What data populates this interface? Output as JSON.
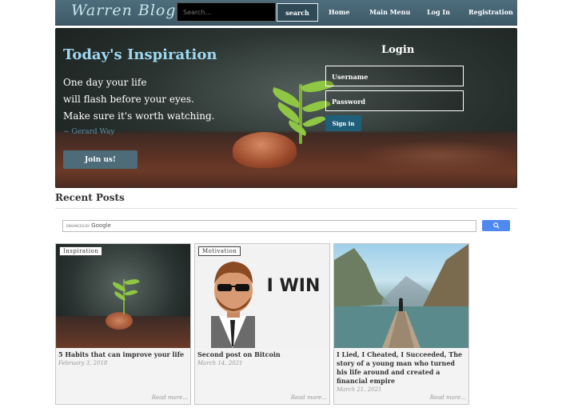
{
  "navbar": {
    "logo": "Warren Blog",
    "search_placeholder": "Search...",
    "search_button": "search",
    "links": [
      "Home",
      "Main Menu",
      "Log In",
      "Registration"
    ]
  },
  "hero": {
    "title": "Today's Inspiration",
    "quote_lines": [
      "One day your life",
      "will flash before your eyes.",
      "Make sure it's worth watching."
    ],
    "quote_author": "~ Gerard Way",
    "join_button": "Join us!"
  },
  "login": {
    "title": "Login",
    "username_placeholder": "Username",
    "password_placeholder": "Password",
    "signin_button": "Sign in"
  },
  "recent": {
    "title": "Recent Posts",
    "google_search": {
      "enhanced_by": "ENHANCED BY",
      "brand": "Google",
      "button_icon": "search-icon"
    }
  },
  "posts": [
    {
      "category": "Inspiration",
      "title": "5 Habits that can improve your life",
      "date": "February 3, 2018",
      "read_more": "Read more..."
    },
    {
      "category": "Motivation",
      "title": "Second post on Bitcoin",
      "date": "March 14, 2021",
      "read_more": "Read more...",
      "image_text": "I WIN"
    },
    {
      "category": "",
      "title": "I Lied, I Cheated, I Succeeded, The story of a young man who turned his life around and created a financial empire",
      "date": "March 21, 2021",
      "read_more": "Read more..."
    }
  ]
}
